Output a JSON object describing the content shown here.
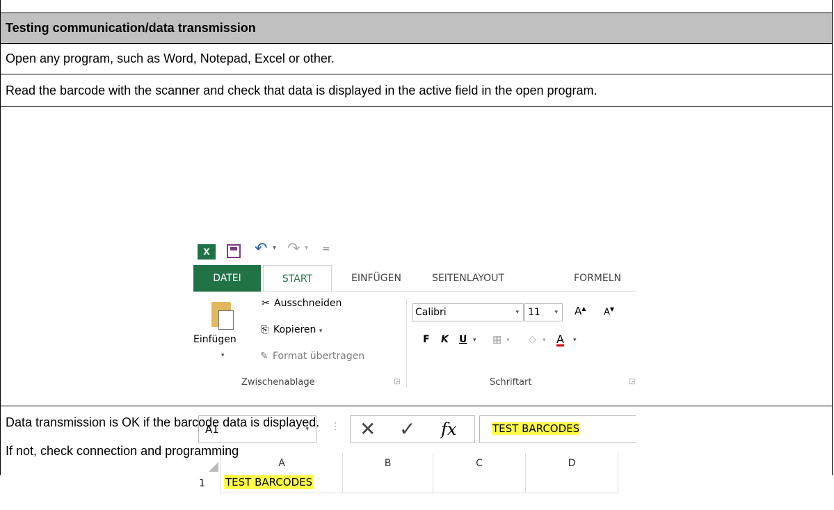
{
  "title": "Testing communication/data transmission",
  "step1": "Open any program, such as Word, Notepad, Excel or other.",
  "step2": "Read the barcode with the scanner and check that data is displayed in the active field in the open program.",
  "result1": "Data transmission is OK if the barcode data is displayed.",
  "result2": "If not, check connection and programming",
  "excel": {
    "logo": "X",
    "tabs": [
      "DATEI",
      "START",
      "EINFÜGEN",
      "SEITENLAYOUT",
      "FORMELN"
    ],
    "paste_label": "Einfügen",
    "cut_label": "Ausschneiden",
    "copy_label": "Kopieren",
    "format_label": "Format übertragen",
    "clipboard_group": "Zwischenablage",
    "font_name": "Calibri",
    "font_size": "11",
    "grow_font": "A",
    "shrink_font": "A",
    "bold": "F",
    "italic": "K",
    "underline": "U",
    "font_color": "A",
    "font_group": "Schriftart",
    "name_box": "A1",
    "fx": "fx",
    "formula_value": "TEST BARCODES",
    "columns": [
      "A",
      "B",
      "C",
      "D"
    ],
    "row_number": "1",
    "cell_a1": "TEST BARCODES",
    "highlight_color": "#ffff47",
    "accent_color": "#217346"
  }
}
